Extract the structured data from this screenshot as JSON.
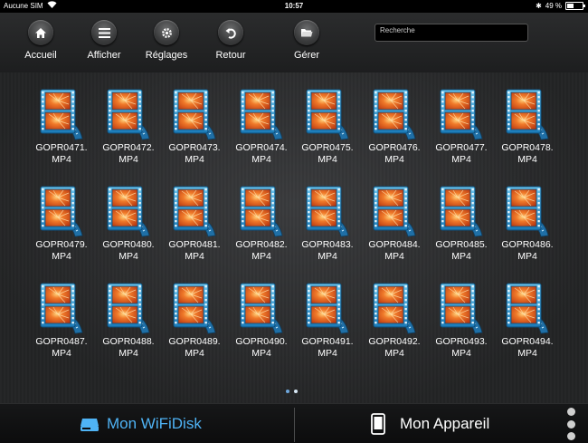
{
  "status_bar": {
    "carrier": "Aucune SIM",
    "time": "10:57",
    "battery": "49 %",
    "battery_level": 0.49
  },
  "toolbar": {
    "buttons": [
      {
        "label": "Accueil",
        "icon": "home-icon"
      },
      {
        "label": "Afficher",
        "icon": "list-icon"
      },
      {
        "label": "Réglages",
        "icon": "gear-icon"
      },
      {
        "label": "Retour",
        "icon": "back-arrow-icon"
      },
      {
        "label": "Gérer",
        "icon": "folder-icon"
      }
    ],
    "search_placeholder": "Recherche"
  },
  "files": [
    {
      "name_line1": "GOPR0471.",
      "name_line2": "MP4"
    },
    {
      "name_line1": "GOPR0472.",
      "name_line2": "MP4"
    },
    {
      "name_line1": "GOPR0473.",
      "name_line2": "MP4"
    },
    {
      "name_line1": "GOPR0474.",
      "name_line2": "MP4"
    },
    {
      "name_line1": "GOPR0475.",
      "name_line2": "MP4"
    },
    {
      "name_line1": "GOPR0476.",
      "name_line2": "MP4"
    },
    {
      "name_line1": "GOPR0477.",
      "name_line2": "MP4"
    },
    {
      "name_line1": "GOPR0478.",
      "name_line2": "MP4"
    },
    {
      "name_line1": "GOPR0479.",
      "name_line2": "MP4"
    },
    {
      "name_line1": "GOPR0480.",
      "name_line2": "MP4"
    },
    {
      "name_line1": "GOPR0481.",
      "name_line2": "MP4"
    },
    {
      "name_line1": "GOPR0482.",
      "name_line2": "MP4"
    },
    {
      "name_line1": "GOPR0483.",
      "name_line2": "MP4"
    },
    {
      "name_line1": "GOPR0484.",
      "name_line2": "MP4"
    },
    {
      "name_line1": "GOPR0485.",
      "name_line2": "MP4"
    },
    {
      "name_line1": "GOPR0486.",
      "name_line2": "MP4"
    },
    {
      "name_line1": "GOPR0487.",
      "name_line2": "MP4"
    },
    {
      "name_line1": "GOPR0488.",
      "name_line2": "MP4"
    },
    {
      "name_line1": "GOPR0489.",
      "name_line2": "MP4"
    },
    {
      "name_line1": "GOPR0490.",
      "name_line2": "MP4"
    },
    {
      "name_line1": "GOPR0491.",
      "name_line2": "MP4"
    },
    {
      "name_line1": "GOPR0492.",
      "name_line2": "MP4"
    },
    {
      "name_line1": "GOPR0493.",
      "name_line2": "MP4"
    },
    {
      "name_line1": "GOPR0494.",
      "name_line2": "MP4"
    }
  ],
  "file_icon": "video-file-icon",
  "pager": {
    "pages": 2,
    "current": 2
  },
  "bottom_tabs": {
    "wifi_label": "Mon WiFiDisk",
    "device_label": "Mon Appareil"
  },
  "colors": {
    "accent": "#4fb3f5"
  }
}
